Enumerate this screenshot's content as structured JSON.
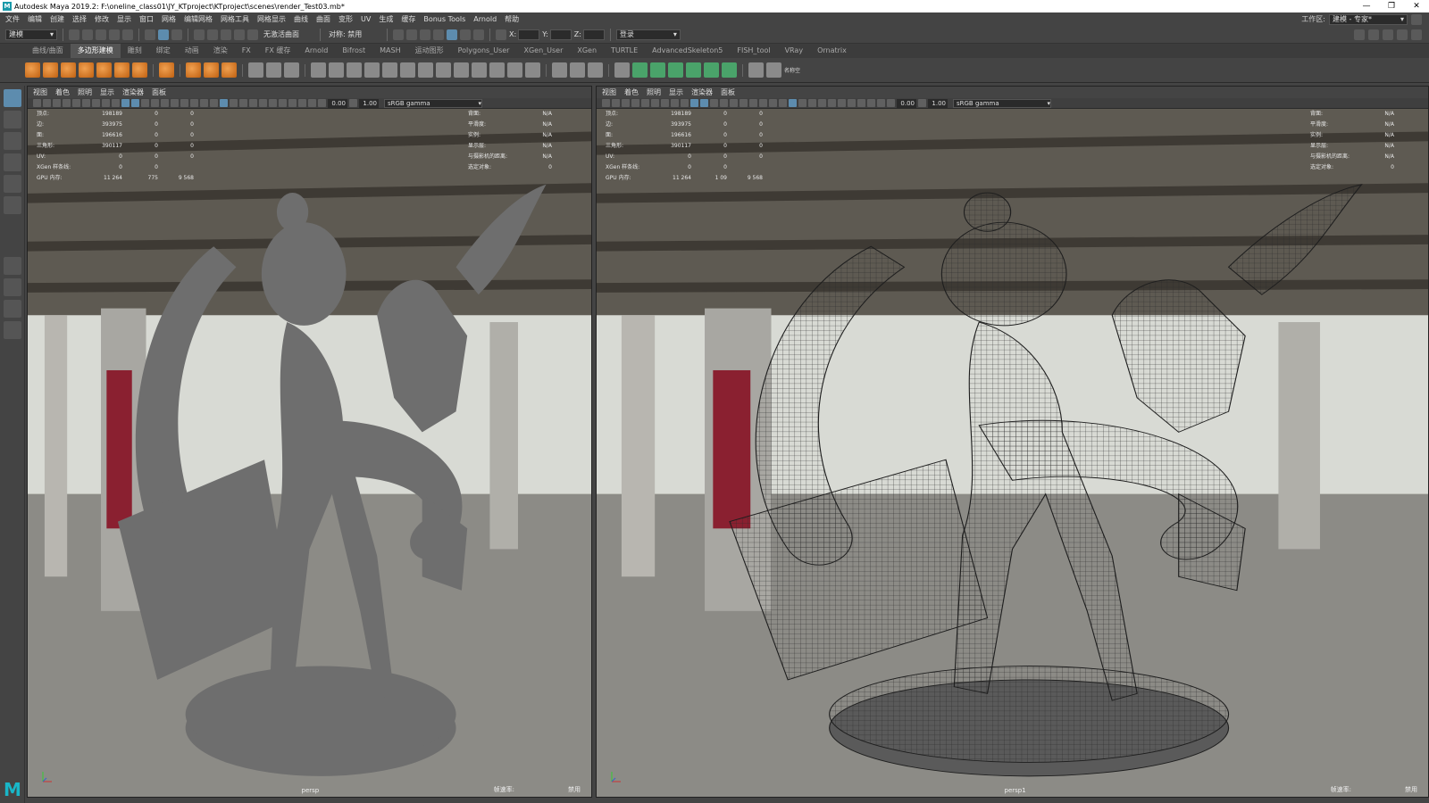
{
  "window": {
    "title": "Autodesk Maya 2019.2: F:\\oneline_class01\\JY_KTproject\\KTproject\\scenes\\render_Test03.mb*",
    "logo": "M",
    "controls": [
      "—",
      "❐",
      "✕"
    ]
  },
  "menubar": {
    "items": [
      "文件",
      "编辑",
      "创建",
      "选择",
      "修改",
      "显示",
      "窗口",
      "网格",
      "编辑网格",
      "网格工具",
      "网格显示",
      "曲线",
      "曲面",
      "变形",
      "UV",
      "生成",
      "缓存",
      "Bonus Tools",
      "Arnold",
      "帮助"
    ],
    "workspace_label": "工作区:",
    "workspace_value": "建模 - 专家*"
  },
  "statusline": {
    "mode": "建模",
    "no_live": "无激活曲面",
    "symmetry": "对称: 禁用",
    "x_label": "X:",
    "y_label": "Y:",
    "z_label": "Z:",
    "login": "登录"
  },
  "shelf": {
    "tabs": [
      "曲线/曲面",
      "多边形建模",
      "雕刻",
      "绑定",
      "动画",
      "渲染",
      "FX",
      "FX 缓存",
      "Arnold",
      "Bifrost",
      "MASH",
      "运动图形",
      "Polygons_User",
      "XGen_User",
      "XGen",
      "TURTLE",
      "AdvancedSkeleton5",
      "FISH_tool",
      "VRay",
      "Ornatrix"
    ],
    "active_tab": "多边形建模",
    "last_icon_label": "名称空"
  },
  "colors": {
    "orange_icon": "#e08a2a",
    "green_icon": "#4aa36a",
    "accent": "#5d8cae",
    "bg_gray": "#444444"
  },
  "viewports": [
    {
      "menu": [
        "视图",
        "着色",
        "照明",
        "显示",
        "渲染器",
        "面板"
      ],
      "num1": "0.00",
      "num2": "1.00",
      "gamma": "sRGB gamma",
      "camera": "persp",
      "wireframe": false,
      "hud_left": [
        [
          "顶点:",
          "198189",
          "0",
          "0"
        ],
        [
          "边:",
          "393975",
          "0",
          "0"
        ],
        [
          "面:",
          "196616",
          "0",
          "0"
        ],
        [
          "三角形:",
          "390117",
          "0",
          "0"
        ],
        [
          "UV:",
          "0",
          "0",
          "0"
        ],
        [
          "XGen 样条线:",
          "0",
          "0",
          ""
        ],
        [
          "GPU 内存:",
          "11 264",
          "775",
          "9 568"
        ]
      ],
      "hud_right": [
        [
          "背面:",
          "N/A"
        ],
        [
          "平滑度:",
          "N/A"
        ],
        [
          "实例:",
          "N/A"
        ],
        [
          "显示层:",
          "N/A"
        ],
        [
          "与摄影机的距离:",
          "N/A"
        ],
        [
          "选定对象:",
          "0"
        ]
      ],
      "bottom_right": [
        "帧速率:",
        "禁用"
      ]
    },
    {
      "menu": [
        "视图",
        "着色",
        "照明",
        "显示",
        "渲染器",
        "面板"
      ],
      "num1": "0.00",
      "num2": "1.00",
      "gamma": "sRGB gamma",
      "camera": "persp1",
      "wireframe": true,
      "hud_left": [
        [
          "顶点:",
          "198189",
          "0",
          "0"
        ],
        [
          "边:",
          "393975",
          "0",
          "0"
        ],
        [
          "面:",
          "196616",
          "0",
          "0"
        ],
        [
          "三角形:",
          "390117",
          "0",
          "0"
        ],
        [
          "UV:",
          "0",
          "0",
          "0"
        ],
        [
          "XGen 样条线:",
          "0",
          "0",
          ""
        ],
        [
          "GPU 内存:",
          "11 264",
          "1 09",
          "9 568"
        ]
      ],
      "hud_right": [
        [
          "背面:",
          "N/A"
        ],
        [
          "平滑度:",
          "N/A"
        ],
        [
          "实例:",
          "N/A"
        ],
        [
          "显示层:",
          "N/A"
        ],
        [
          "与摄影机的距离:",
          "N/A"
        ],
        [
          "选定对象:",
          "0"
        ]
      ],
      "bottom_right": [
        "帧速率:",
        "禁用"
      ]
    }
  ]
}
